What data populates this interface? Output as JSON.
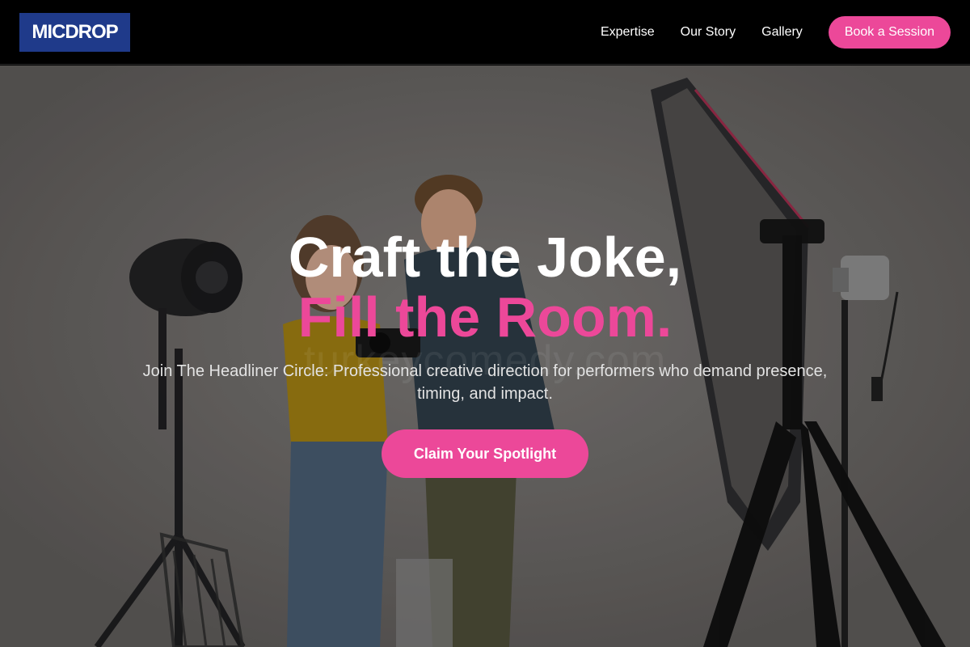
{
  "brand": {
    "logo_text": "MICDROP",
    "logo_bg": "#1f3a8a"
  },
  "nav": {
    "links": [
      "Expertise",
      "Our Story",
      "Gallery"
    ],
    "cta_label": "Book a Session"
  },
  "hero": {
    "headline_line1": "Craft the Joke,",
    "headline_line2": "Fill the Room.",
    "subtext": "Join The Headliner Circle: Professional creative direction for performers who demand presence, timing, and impact.",
    "cta_label": "Claim Your Spotlight",
    "watermark": "turkeycomedy.com",
    "image_description_icon": "photo-studio-couple-image"
  },
  "colors": {
    "accent": "#ec4899",
    "header_bg": "#000000",
    "brand_blue": "#1f3a8a"
  }
}
